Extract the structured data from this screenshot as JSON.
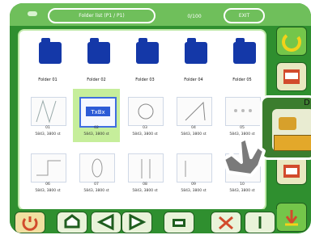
{
  "header": {
    "title": "Folder list (P1 / P1)",
    "counter": "0/100",
    "right_label": "EXIT"
  },
  "grid": {
    "folders": [
      {
        "label": "Folder 01"
      },
      {
        "label": "Folder 02"
      },
      {
        "label": "Folder 03"
      },
      {
        "label": "Folder 04"
      },
      {
        "label": "Folder 05"
      }
    ],
    "row2": [
      {
        "label": "01",
        "sub": "5843, 3800 st"
      },
      {
        "label": "02",
        "sub": "5843, 3800 st"
      },
      {
        "label": "03",
        "sub": "5843, 3800 st"
      },
      {
        "label": "04",
        "sub": "5843, 3800 st"
      },
      {
        "label": "05",
        "sub": "5843, 3800 st"
      }
    ],
    "row3": [
      {
        "label": "06",
        "sub": "5843, 3800 st"
      },
      {
        "label": "07",
        "sub": "5843, 3800 st"
      },
      {
        "label": "08",
        "sub": "5843, 3800 st"
      },
      {
        "label": "09",
        "sub": "5843, 3800 st"
      },
      {
        "label": "10",
        "sub": "5843, 3800 st"
      }
    ]
  },
  "callout": {
    "letter": "D"
  },
  "bottom": {
    "labels": [
      "",
      "",
      "",
      "",
      "",
      "",
      "",
      ""
    ]
  },
  "colors": {
    "green_dark": "#2f8f2f",
    "panel_border": "#bfe9a8",
    "folder_blue": "#1438a8",
    "selected_green": "#c6ee9b"
  }
}
